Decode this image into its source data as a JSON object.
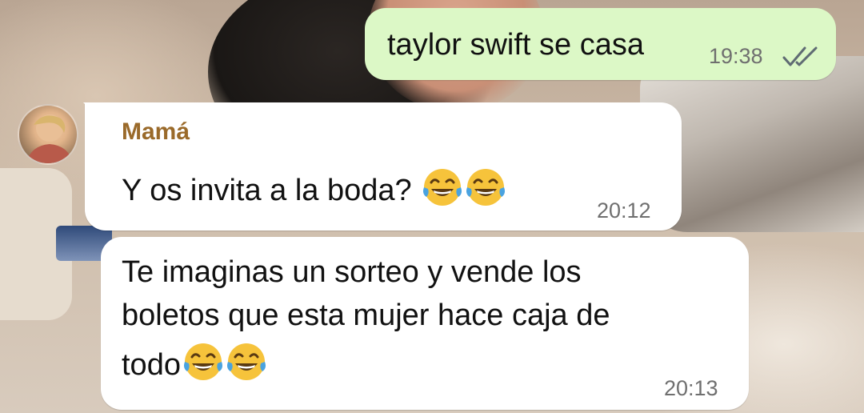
{
  "messages": [
    {
      "direction": "outgoing",
      "text": "taylor swift se casa",
      "time": "19:38",
      "status_icon": "double-check-icon"
    },
    {
      "direction": "incoming",
      "sender": "Mamá",
      "text": "Y os invita a la boda?",
      "emojis": [
        "face-with-tears-of-joy",
        "face-with-tears-of-joy"
      ],
      "time": "20:12"
    },
    {
      "direction": "incoming",
      "lines": [
        "Te imaginas un sorteo y vende los",
        "boletos que esta mujer hace caja de",
        "todo"
      ],
      "emojis": [
        "face-with-tears-of-joy",
        "face-with-tears-of-joy"
      ],
      "time": "20:13"
    }
  ],
  "colors": {
    "outgoing_bubble": "#dcf8c6",
    "incoming_bubble": "#ffffff",
    "sender_name": "#9a6a2a",
    "timestamp": "#6f6f6f",
    "read_check": "#5f6b73"
  }
}
